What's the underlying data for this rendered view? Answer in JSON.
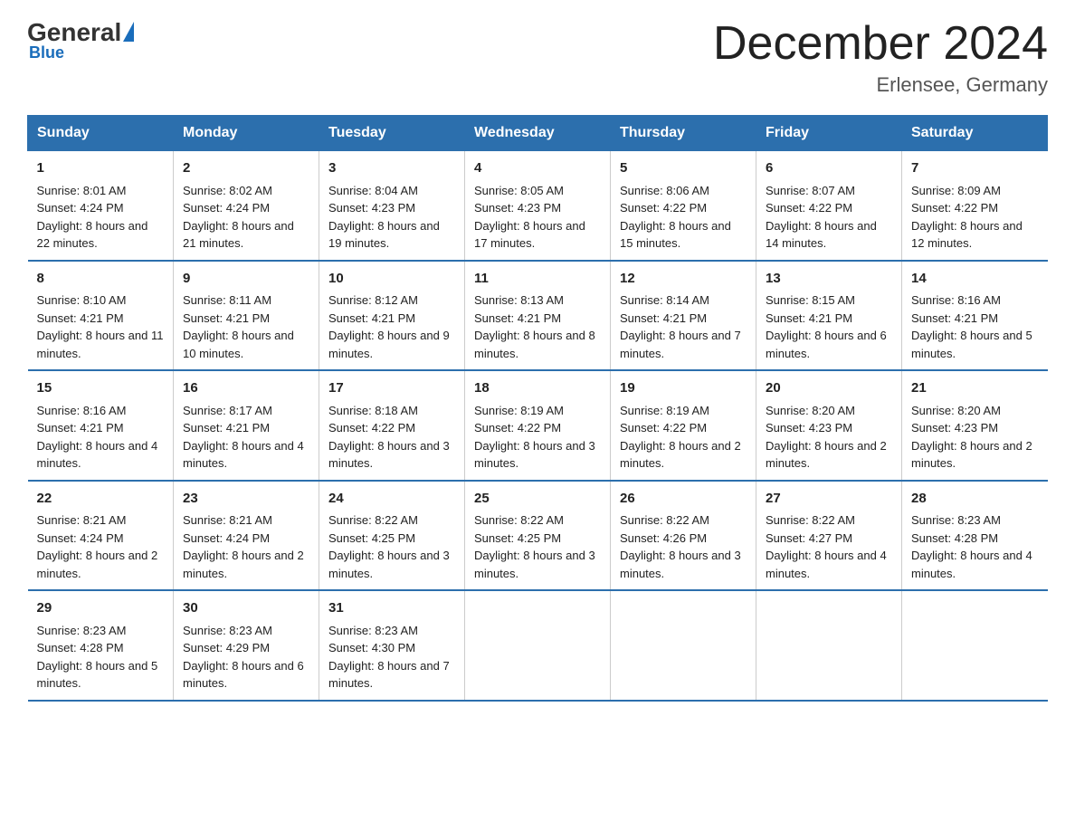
{
  "header": {
    "logo_general": "General",
    "logo_blue": "Blue",
    "month_title": "December 2024",
    "location": "Erlensee, Germany"
  },
  "weekdays": [
    "Sunday",
    "Monday",
    "Tuesday",
    "Wednesday",
    "Thursday",
    "Friday",
    "Saturday"
  ],
  "weeks": [
    [
      {
        "day": "1",
        "sunrise": "8:01 AM",
        "sunset": "4:24 PM",
        "daylight": "8 hours and 22 minutes."
      },
      {
        "day": "2",
        "sunrise": "8:02 AM",
        "sunset": "4:24 PM",
        "daylight": "8 hours and 21 minutes."
      },
      {
        "day": "3",
        "sunrise": "8:04 AM",
        "sunset": "4:23 PM",
        "daylight": "8 hours and 19 minutes."
      },
      {
        "day": "4",
        "sunrise": "8:05 AM",
        "sunset": "4:23 PM",
        "daylight": "8 hours and 17 minutes."
      },
      {
        "day": "5",
        "sunrise": "8:06 AM",
        "sunset": "4:22 PM",
        "daylight": "8 hours and 15 minutes."
      },
      {
        "day": "6",
        "sunrise": "8:07 AM",
        "sunset": "4:22 PM",
        "daylight": "8 hours and 14 minutes."
      },
      {
        "day": "7",
        "sunrise": "8:09 AM",
        "sunset": "4:22 PM",
        "daylight": "8 hours and 12 minutes."
      }
    ],
    [
      {
        "day": "8",
        "sunrise": "8:10 AM",
        "sunset": "4:21 PM",
        "daylight": "8 hours and 11 minutes."
      },
      {
        "day": "9",
        "sunrise": "8:11 AM",
        "sunset": "4:21 PM",
        "daylight": "8 hours and 10 minutes."
      },
      {
        "day": "10",
        "sunrise": "8:12 AM",
        "sunset": "4:21 PM",
        "daylight": "8 hours and 9 minutes."
      },
      {
        "day": "11",
        "sunrise": "8:13 AM",
        "sunset": "4:21 PM",
        "daylight": "8 hours and 8 minutes."
      },
      {
        "day": "12",
        "sunrise": "8:14 AM",
        "sunset": "4:21 PM",
        "daylight": "8 hours and 7 minutes."
      },
      {
        "day": "13",
        "sunrise": "8:15 AM",
        "sunset": "4:21 PM",
        "daylight": "8 hours and 6 minutes."
      },
      {
        "day": "14",
        "sunrise": "8:16 AM",
        "sunset": "4:21 PM",
        "daylight": "8 hours and 5 minutes."
      }
    ],
    [
      {
        "day": "15",
        "sunrise": "8:16 AM",
        "sunset": "4:21 PM",
        "daylight": "8 hours and 4 minutes."
      },
      {
        "day": "16",
        "sunrise": "8:17 AM",
        "sunset": "4:21 PM",
        "daylight": "8 hours and 4 minutes."
      },
      {
        "day": "17",
        "sunrise": "8:18 AM",
        "sunset": "4:22 PM",
        "daylight": "8 hours and 3 minutes."
      },
      {
        "day": "18",
        "sunrise": "8:19 AM",
        "sunset": "4:22 PM",
        "daylight": "8 hours and 3 minutes."
      },
      {
        "day": "19",
        "sunrise": "8:19 AM",
        "sunset": "4:22 PM",
        "daylight": "8 hours and 2 minutes."
      },
      {
        "day": "20",
        "sunrise": "8:20 AM",
        "sunset": "4:23 PM",
        "daylight": "8 hours and 2 minutes."
      },
      {
        "day": "21",
        "sunrise": "8:20 AM",
        "sunset": "4:23 PM",
        "daylight": "8 hours and 2 minutes."
      }
    ],
    [
      {
        "day": "22",
        "sunrise": "8:21 AM",
        "sunset": "4:24 PM",
        "daylight": "8 hours and 2 minutes."
      },
      {
        "day": "23",
        "sunrise": "8:21 AM",
        "sunset": "4:24 PM",
        "daylight": "8 hours and 2 minutes."
      },
      {
        "day": "24",
        "sunrise": "8:22 AM",
        "sunset": "4:25 PM",
        "daylight": "8 hours and 3 minutes."
      },
      {
        "day": "25",
        "sunrise": "8:22 AM",
        "sunset": "4:25 PM",
        "daylight": "8 hours and 3 minutes."
      },
      {
        "day": "26",
        "sunrise": "8:22 AM",
        "sunset": "4:26 PM",
        "daylight": "8 hours and 3 minutes."
      },
      {
        "day": "27",
        "sunrise": "8:22 AM",
        "sunset": "4:27 PM",
        "daylight": "8 hours and 4 minutes."
      },
      {
        "day": "28",
        "sunrise": "8:23 AM",
        "sunset": "4:28 PM",
        "daylight": "8 hours and 4 minutes."
      }
    ],
    [
      {
        "day": "29",
        "sunrise": "8:23 AM",
        "sunset": "4:28 PM",
        "daylight": "8 hours and 5 minutes."
      },
      {
        "day": "30",
        "sunrise": "8:23 AM",
        "sunset": "4:29 PM",
        "daylight": "8 hours and 6 minutes."
      },
      {
        "day": "31",
        "sunrise": "8:23 AM",
        "sunset": "4:30 PM",
        "daylight": "8 hours and 7 minutes."
      },
      null,
      null,
      null,
      null
    ]
  ]
}
